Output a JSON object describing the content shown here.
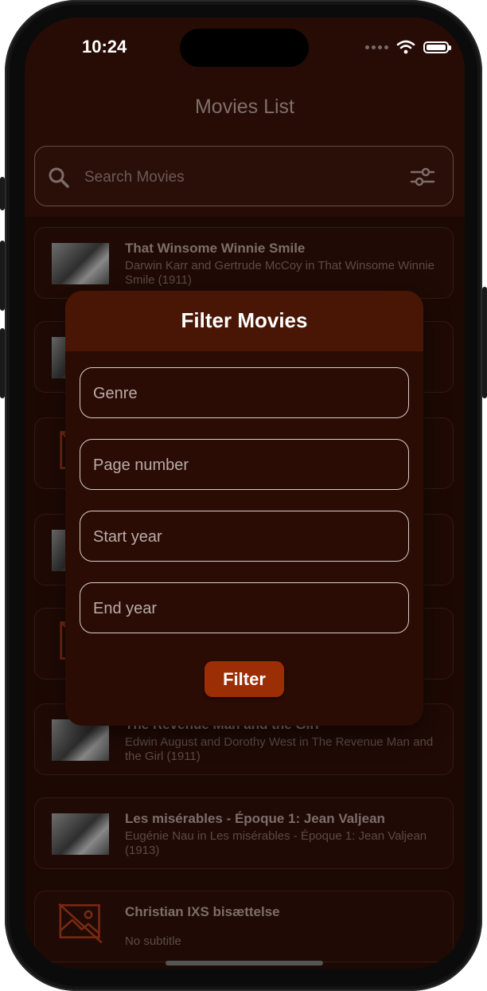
{
  "status": {
    "time": "10:24"
  },
  "app": {
    "title": "Movies List",
    "search_placeholder": "Search Movies"
  },
  "movies": [
    {
      "title": "That Winsome Winnie Smile",
      "subtitle": "Darwin Karr and Gertrude McCoy in That Winsome Winnie Smile (1911)",
      "thumb": "photo"
    },
    {
      "title": "",
      "subtitle": "",
      "thumb": "photo"
    },
    {
      "title": "",
      "subtitle": "",
      "thumb": "broken-image-icon"
    },
    {
      "title": "",
      "subtitle": "",
      "thumb": "photo"
    },
    {
      "title": "",
      "subtitle": "",
      "thumb": "broken-image-icon"
    },
    {
      "title": "The Revenue Man and the Girl",
      "subtitle": "Edwin August and Dorothy West in The Revenue Man and the Girl (1911)",
      "thumb": "photo"
    },
    {
      "title": "Les misérables - Époque 1: Jean Valjean",
      "subtitle": "Eugénie Nau in Les misérables - Époque 1: Jean Valjean (1913)",
      "thumb": "photo"
    },
    {
      "title": "Christian IXS bisættelse",
      "subtitle": "No subtitle",
      "thumb": "broken-image-icon"
    }
  ],
  "modal": {
    "title": "Filter Movies",
    "genre_placeholder": "Genre",
    "page_placeholder": "Page number",
    "start_year_placeholder": "Start year",
    "end_year_placeholder": "End year",
    "filter_label": "Filter"
  },
  "colors": {
    "background": "#1d0904",
    "accent": "#9c2e05",
    "modal_header": "#491605"
  }
}
